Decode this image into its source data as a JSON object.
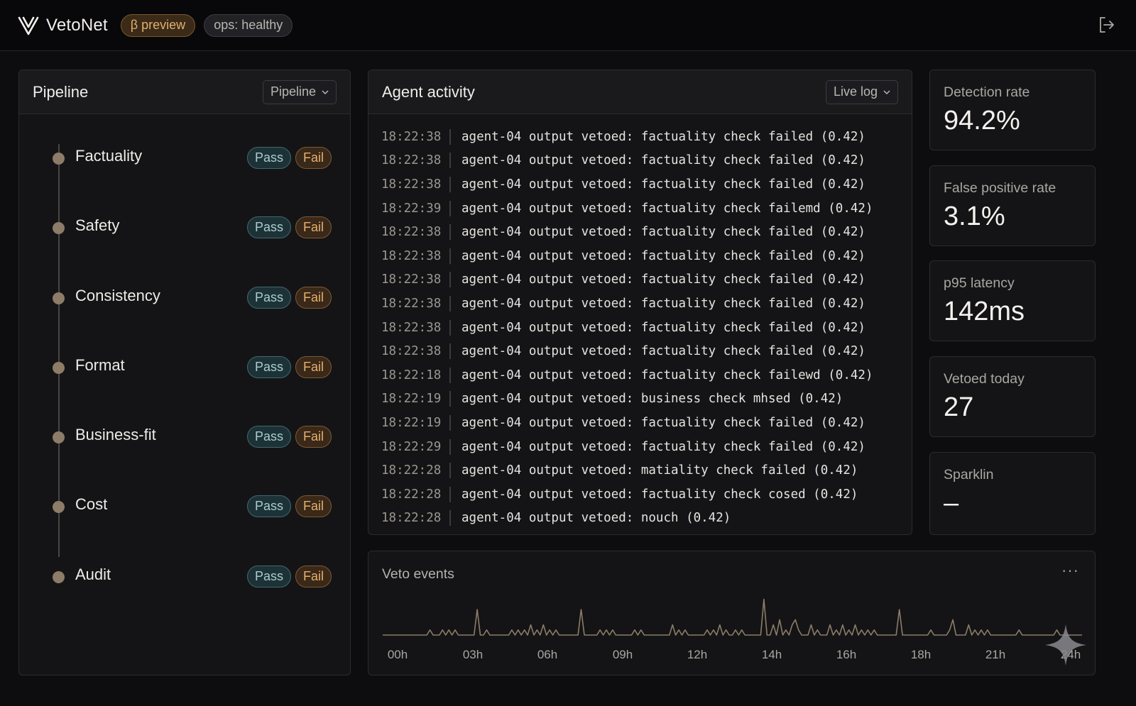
{
  "header": {
    "brand": "VetoNet",
    "beta_label": "β preview",
    "ops_label": "ops: healthy",
    "logout_icon": "logout-icon"
  },
  "pipeline": {
    "title": "Pipeline",
    "dropdown_value": "Pipeline",
    "steps": [
      {
        "label": "Factuality",
        "pass": "Pass",
        "fail": "Fail"
      },
      {
        "label": "Safety",
        "pass": "Pass",
        "fail": "Fail"
      },
      {
        "label": "Consistency",
        "pass": "Pass",
        "fail": "Fail"
      },
      {
        "label": "Format",
        "pass": "Pass",
        "fail": "Fail"
      },
      {
        "label": "Business-fit",
        "pass": "Pass",
        "fail": "Fail"
      },
      {
        "label": "Cost",
        "pass": "Pass",
        "fail": "Fail"
      },
      {
        "label": "Audit",
        "pass": "Pass",
        "fail": "Fail"
      }
    ]
  },
  "activity": {
    "title": "Agent activity",
    "dropdown_value": "Live log",
    "rows": [
      {
        "time": "18:22:38",
        "msg": "agent-04 output vetoed: factuality check failed (0.42)"
      },
      {
        "time": "18:22:38",
        "msg": "agent-04 output vetoed: factuality check failed (0.42)"
      },
      {
        "time": "18:22:38",
        "msg": "agent-04 output vetoed: factuality check failed (0.42)"
      },
      {
        "time": "18:22:39",
        "msg": "agent-04 output vetoed: factuality check failemd (0.42)"
      },
      {
        "time": "18:22:38",
        "msg": "agent-04 output vetoed: factuality check failed (0.42)"
      },
      {
        "time": "18:22:38",
        "msg": "agent-04 output vetoed: factuality check failed (0.42)"
      },
      {
        "time": "18:22:38",
        "msg": "agent-04 output vetoed: factuality check failed (0.42)"
      },
      {
        "time": "18:22:38",
        "msg": "agent-04 output vetoed: factuality check failed (0.42)"
      },
      {
        "time": "18:22:38",
        "msg": "agent-04 output vetoed: factuality check failed (0.42)"
      },
      {
        "time": "18:22:38",
        "msg": "agent-04 output vetoed: factuality check failed (0.42)"
      },
      {
        "time": "18:22:18",
        "msg": "agent-04 output vetoed: factuality check failewd (0.42)"
      },
      {
        "time": "18:22:19",
        "msg": "agent-04 output vetoed: business check mhsed (0.42)"
      },
      {
        "time": "18:22:19",
        "msg": "agent-04 output vetoed: factuality check failed (0.42)"
      },
      {
        "time": "18:22:29",
        "msg": "agent-04 output vetoed: factuality check failed (0.42)"
      },
      {
        "time": "18:22:28",
        "msg": "agent-04 output vetoed: matiality check failed (0.42)"
      },
      {
        "time": "18:22:28",
        "msg": "agent-04 output vetoed: factuality check cosed (0.42)"
      },
      {
        "time": "18:22:28",
        "msg": "agent-04 output vetoed: nouch (0.42)"
      }
    ]
  },
  "stats": [
    {
      "label": "Detection rate",
      "value": "94.2%"
    },
    {
      "label": "False positive rate",
      "value": "3.1%"
    },
    {
      "label": "p95 latency",
      "value": "142ms"
    },
    {
      "label": "Vetoed today",
      "value": "27"
    },
    {
      "label": "Sparklin",
      "value": "–"
    }
  ],
  "veto": {
    "title": "Veto events",
    "more": "···"
  },
  "chart_data": {
    "type": "line",
    "x_ticks": [
      "00h",
      "03h",
      "06h",
      "09h",
      "12h",
      "14h",
      "16h",
      "18h",
      "21h",
      "24h"
    ],
    "values": [
      0,
      0,
      0,
      0,
      0,
      0,
      0,
      0,
      0,
      0,
      0,
      0,
      0,
      0,
      0,
      1,
      0,
      0,
      0,
      1,
      0,
      1,
      0,
      1,
      0,
      0,
      0,
      0,
      0,
      0,
      5,
      0,
      0,
      1,
      0,
      0,
      0,
      0,
      0,
      0,
      0,
      1,
      0,
      1,
      0,
      1,
      0,
      2,
      0,
      1,
      0,
      2,
      0,
      1,
      0,
      1,
      0,
      0,
      0,
      0,
      0,
      0,
      0,
      0,
      0,
      0,
      0,
      0,
      0,
      1,
      0,
      1,
      0,
      1,
      0,
      0,
      0,
      0,
      0,
      0,
      1,
      0,
      1,
      0,
      0,
      0,
      0,
      0,
      0,
      0,
      0,
      0,
      2,
      0,
      1,
      0,
      1,
      0,
      0,
      0,
      0,
      0,
      0,
      1,
      0,
      1,
      0,
      2,
      0,
      1,
      0,
      0,
      1,
      0,
      1,
      0,
      0,
      0,
      0,
      0,
      0,
      0,
      0,
      0,
      2,
      0,
      3,
      0,
      1,
      0,
      2,
      0,
      1,
      0,
      0,
      0,
      2,
      0,
      1,
      0,
      0,
      0,
      2,
      0,
      1,
      0,
      2,
      0,
      1,
      0,
      0,
      0,
      1,
      0,
      1,
      0,
      1,
      0,
      0,
      0,
      0,
      0,
      0,
      0,
      3,
      0,
      0,
      0,
      0,
      0,
      0,
      0,
      0,
      0,
      1,
      0,
      0,
      0,
      0,
      0,
      1,
      0,
      0,
      0,
      0,
      0,
      2,
      0,
      1,
      0,
      1,
      0,
      1,
      0,
      0,
      0,
      0,
      0,
      0,
      0,
      0,
      0,
      1,
      0,
      0,
      0,
      0,
      0,
      0,
      0,
      0,
      0,
      0,
      0,
      1,
      0,
      0,
      0,
      0,
      0,
      0,
      0,
      0
    ],
    "peaks": [
      {
        "x": 0.284,
        "v": 5
      },
      {
        "x": 0.543,
        "v": 7
      },
      {
        "x": 0.74,
        "v": 5
      },
      {
        "x": 0.815,
        "v": 3
      },
      {
        "x": 0.59,
        "v": 3
      },
      {
        "x": 0.677,
        "v": 2
      }
    ],
    "title": "Veto events",
    "xlabel": "",
    "ylabel": ""
  },
  "colors": {
    "accent_pass": "#a9cdd0",
    "accent_fail": "#e6b06d",
    "line": "#8c7c68"
  }
}
